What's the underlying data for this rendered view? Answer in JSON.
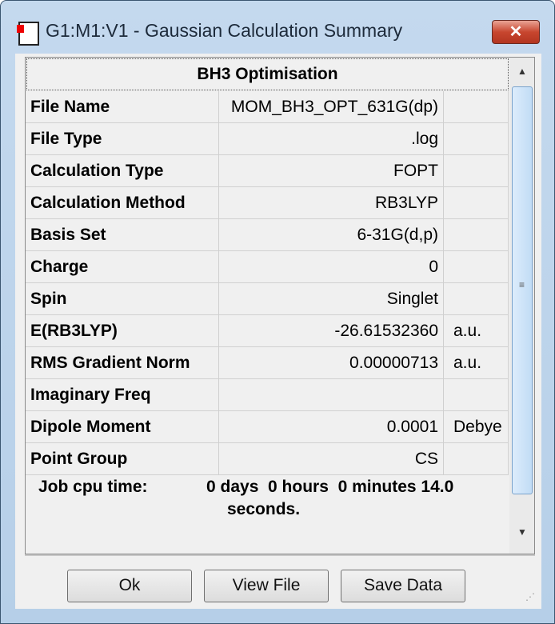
{
  "window": {
    "title": "G1:M1:V1 - Gaussian Calculation Summary",
    "close": "✕"
  },
  "table": {
    "header": "BH3 Optimisation",
    "rows": [
      {
        "label": "File Name",
        "value": "MOM_BH3_OPT_631G(dp)",
        "unit": ""
      },
      {
        "label": "File Type",
        "value": ".log",
        "unit": ""
      },
      {
        "label": "Calculation Type",
        "value": "FOPT",
        "unit": ""
      },
      {
        "label": "Calculation Method",
        "value": "RB3LYP",
        "unit": ""
      },
      {
        "label": "Basis Set",
        "value": "6-31G(d,p)",
        "unit": ""
      },
      {
        "label": "Charge",
        "value": "0",
        "unit": ""
      },
      {
        "label": "Spin",
        "value": "Singlet",
        "unit": ""
      },
      {
        "label": "E(RB3LYP)",
        "value": "-26.61532360",
        "unit": "a.u."
      },
      {
        "label": "RMS Gradient Norm",
        "value": "0.00000713",
        "unit": "a.u."
      },
      {
        "label": "Imaginary Freq",
        "value": "",
        "unit": ""
      },
      {
        "label": "Dipole Moment",
        "value": "0.0001",
        "unit": "Debye"
      },
      {
        "label": "Point Group",
        "value": "CS",
        "unit": ""
      }
    ],
    "cpu_label": "Job cpu time:",
    "cpu_value": "0 days  0 hours  0 minutes 14.0",
    "cpu_value2": "seconds."
  },
  "buttons": {
    "ok": "Ok",
    "view": "View File",
    "save": "Save Data"
  }
}
